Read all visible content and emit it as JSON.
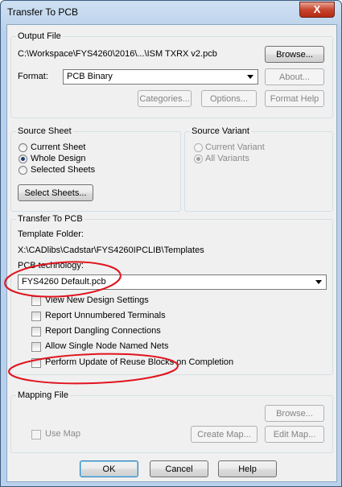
{
  "title": "Transfer To PCB",
  "close_symbol": "X",
  "output_file": {
    "group_label": "Output File",
    "path": "C:\\Workspace\\FYS4260\\2016\\...\\ISM TXRX v2.pcb",
    "browse": "Browse...",
    "format_label": "Format:",
    "format_value": "PCB Binary",
    "about": "About...",
    "categories": "Categories...",
    "options": "Options...",
    "format_help": "Format Help"
  },
  "source_sheet": {
    "group_label": "Source Sheet",
    "options": [
      "Current Sheet",
      "Whole Design",
      "Selected Sheets"
    ],
    "selected": "Whole Design",
    "select_sheets": "Select Sheets..."
  },
  "source_variant": {
    "group_label": "Source Variant",
    "options": [
      "Current Variant",
      "All Variants"
    ],
    "selected": "All Variants"
  },
  "transfer": {
    "group_label": "Transfer To PCB",
    "template_folder_label": "Template Folder:",
    "template_folder": "X:\\CADlibs\\Cadstar\\FYS4260IPCLIB\\Templates",
    "pcb_tech_label": "PCB technology:",
    "pcb_tech_value": "FYS4260 Default.pcb",
    "checks": [
      "View New Design Settings",
      "Report Unnumbered Terminals",
      "Report Dangling Connections",
      "Allow Single Node Named Nets",
      "Perform Update of Reuse Blocks on Completion"
    ]
  },
  "mapping": {
    "group_label": "Mapping File",
    "browse": "Browse...",
    "use_map": "Use Map",
    "create_map": "Create Map...",
    "edit_map": "Edit Map..."
  },
  "footer": {
    "ok": "OK",
    "cancel": "Cancel",
    "help": "Help"
  },
  "annotation_color": "#e0141e"
}
